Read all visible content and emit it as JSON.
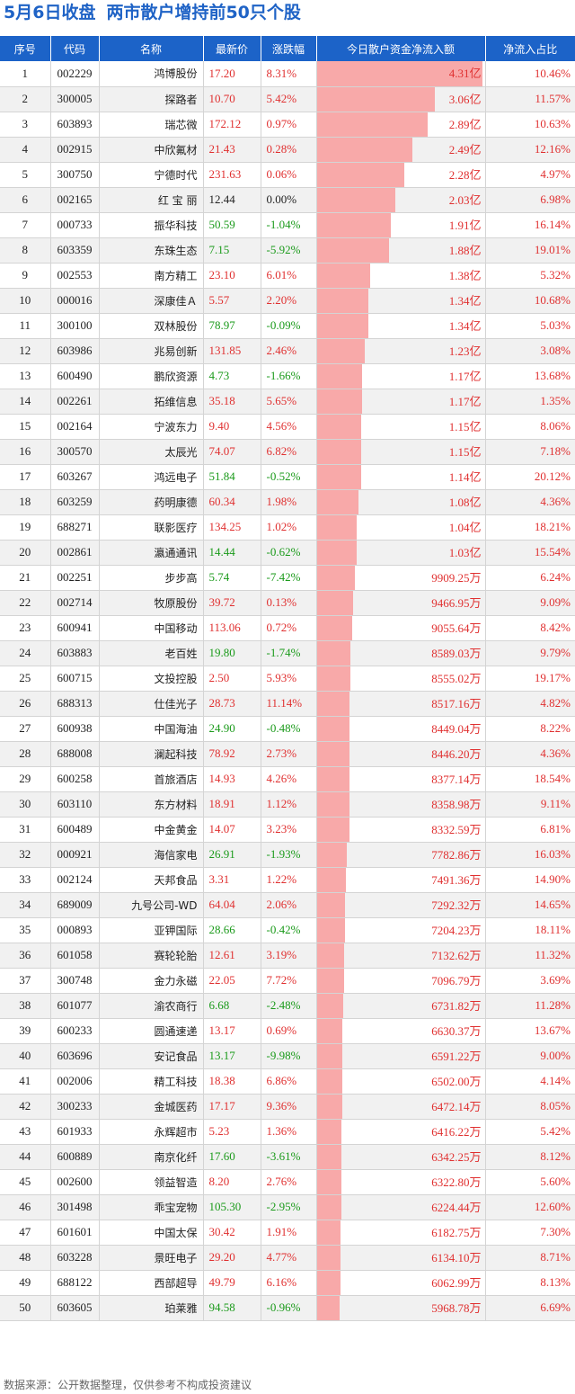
{
  "title": {
    "date": "5月6日收盘",
    "subject": "两市散户增持前50只个股"
  },
  "columns": [
    "序号",
    "代码",
    "名称",
    "最新价",
    "涨跌幅",
    "今日散户资金净流入额",
    "净流入占比"
  ],
  "colors": {
    "header_bg": "#1c63c8",
    "title": "#1f63c6",
    "bar": "#f8a9a9",
    "up": "#e03030",
    "down": "#1a9a1a"
  },
  "rows": [
    {
      "idx": "1",
      "code": "002229",
      "name": "鸿博股份",
      "price": "17.20",
      "chg": "8.31%",
      "flow": "4.31亿",
      "flow_yuan": 431000000,
      "pct": "10.46%"
    },
    {
      "idx": "2",
      "code": "300005",
      "name": "探路者",
      "price": "10.70",
      "chg": "5.42%",
      "flow": "3.06亿",
      "flow_yuan": 306000000,
      "pct": "11.57%"
    },
    {
      "idx": "3",
      "code": "603893",
      "name": "瑞芯微",
      "price": "172.12",
      "chg": "0.97%",
      "flow": "2.89亿",
      "flow_yuan": 289000000,
      "pct": "10.63%"
    },
    {
      "idx": "4",
      "code": "002915",
      "name": "中欣氟材",
      "price": "21.43",
      "chg": "0.28%",
      "flow": "2.49亿",
      "flow_yuan": 249000000,
      "pct": "12.16%"
    },
    {
      "idx": "5",
      "code": "300750",
      "name": "宁德时代",
      "price": "231.63",
      "chg": "0.06%",
      "flow": "2.28亿",
      "flow_yuan": 228000000,
      "pct": "4.97%"
    },
    {
      "idx": "6",
      "code": "002165",
      "name": "红 宝 丽",
      "price": "12.44",
      "chg": "0.00%",
      "flow": "2.03亿",
      "flow_yuan": 203000000,
      "pct": "6.98%"
    },
    {
      "idx": "7",
      "code": "000733",
      "name": "振华科技",
      "price": "50.59",
      "chg": "-1.04%",
      "flow": "1.91亿",
      "flow_yuan": 191000000,
      "pct": "16.14%"
    },
    {
      "idx": "8",
      "code": "603359",
      "name": "东珠生态",
      "price": "7.15",
      "chg": "-5.92%",
      "flow": "1.88亿",
      "flow_yuan": 188000000,
      "pct": "19.01%"
    },
    {
      "idx": "9",
      "code": "002553",
      "name": "南方精工",
      "price": "23.10",
      "chg": "6.01%",
      "flow": "1.38亿",
      "flow_yuan": 138000000,
      "pct": "5.32%"
    },
    {
      "idx": "10",
      "code": "000016",
      "name": "深康佳Ａ",
      "price": "5.57",
      "chg": "2.20%",
      "flow": "1.34亿",
      "flow_yuan": 134000000,
      "pct": "10.68%"
    },
    {
      "idx": "11",
      "code": "300100",
      "name": "双林股份",
      "price": "78.97",
      "chg": "-0.09%",
      "flow": "1.34亿",
      "flow_yuan": 134000000,
      "pct": "5.03%"
    },
    {
      "idx": "12",
      "code": "603986",
      "name": "兆易创新",
      "price": "131.85",
      "chg": "2.46%",
      "flow": "1.23亿",
      "flow_yuan": 123000000,
      "pct": "3.08%"
    },
    {
      "idx": "13",
      "code": "600490",
      "name": "鹏欣资源",
      "price": "4.73",
      "chg": "-1.66%",
      "flow": "1.17亿",
      "flow_yuan": 117000000,
      "pct": "13.68%"
    },
    {
      "idx": "14",
      "code": "002261",
      "name": "拓维信息",
      "price": "35.18",
      "chg": "5.65%",
      "flow": "1.17亿",
      "flow_yuan": 117000000,
      "pct": "1.35%"
    },
    {
      "idx": "15",
      "code": "002164",
      "name": "宁波东力",
      "price": "9.40",
      "chg": "4.56%",
      "flow": "1.15亿",
      "flow_yuan": 115000000,
      "pct": "8.06%"
    },
    {
      "idx": "16",
      "code": "300570",
      "name": "太辰光",
      "price": "74.07",
      "chg": "6.82%",
      "flow": "1.15亿",
      "flow_yuan": 115000000,
      "pct": "7.18%"
    },
    {
      "idx": "17",
      "code": "603267",
      "name": "鸿远电子",
      "price": "51.84",
      "chg": "-0.52%",
      "flow": "1.14亿",
      "flow_yuan": 114000000,
      "pct": "20.12%"
    },
    {
      "idx": "18",
      "code": "603259",
      "name": "药明康德",
      "price": "60.34",
      "chg": "1.98%",
      "flow": "1.08亿",
      "flow_yuan": 108000000,
      "pct": "4.36%"
    },
    {
      "idx": "19",
      "code": "688271",
      "name": "联影医疗",
      "price": "134.25",
      "chg": "1.02%",
      "flow": "1.04亿",
      "flow_yuan": 104000000,
      "pct": "18.21%"
    },
    {
      "idx": "20",
      "code": "002861",
      "name": "瀛通通讯",
      "price": "14.44",
      "chg": "-0.62%",
      "flow": "1.03亿",
      "flow_yuan": 103000000,
      "pct": "15.54%"
    },
    {
      "idx": "21",
      "code": "002251",
      "name": "步步高",
      "price": "5.74",
      "chg": "-7.42%",
      "flow": "9909.25万",
      "flow_yuan": 99092500,
      "pct": "6.24%"
    },
    {
      "idx": "22",
      "code": "002714",
      "name": "牧原股份",
      "price": "39.72",
      "chg": "0.13%",
      "flow": "9466.95万",
      "flow_yuan": 94669500,
      "pct": "9.09%"
    },
    {
      "idx": "23",
      "code": "600941",
      "name": "中国移动",
      "price": "113.06",
      "chg": "0.72%",
      "flow": "9055.64万",
      "flow_yuan": 90556400,
      "pct": "8.42%"
    },
    {
      "idx": "24",
      "code": "603883",
      "name": "老百姓",
      "price": "19.80",
      "chg": "-1.74%",
      "flow": "8589.03万",
      "flow_yuan": 85890300,
      "pct": "9.79%"
    },
    {
      "idx": "25",
      "code": "600715",
      "name": "文投控股",
      "price": "2.50",
      "chg": "5.93%",
      "flow": "8555.02万",
      "flow_yuan": 85550200,
      "pct": "19.17%"
    },
    {
      "idx": "26",
      "code": "688313",
      "name": "仕佳光子",
      "price": "28.73",
      "chg": "11.14%",
      "flow": "8517.16万",
      "flow_yuan": 85171600,
      "pct": "4.82%"
    },
    {
      "idx": "27",
      "code": "600938",
      "name": "中国海油",
      "price": "24.90",
      "chg": "-0.48%",
      "flow": "8449.04万",
      "flow_yuan": 84490400,
      "pct": "8.22%"
    },
    {
      "idx": "28",
      "code": "688008",
      "name": "澜起科技",
      "price": "78.92",
      "chg": "2.73%",
      "flow": "8446.20万",
      "flow_yuan": 84462000,
      "pct": "4.36%"
    },
    {
      "idx": "29",
      "code": "600258",
      "name": "首旅酒店",
      "price": "14.93",
      "chg": "4.26%",
      "flow": "8377.14万",
      "flow_yuan": 83771400,
      "pct": "18.54%"
    },
    {
      "idx": "30",
      "code": "603110",
      "name": "东方材料",
      "price": "18.91",
      "chg": "1.12%",
      "flow": "8358.98万",
      "flow_yuan": 83589800,
      "pct": "9.11%"
    },
    {
      "idx": "31",
      "code": "600489",
      "name": "中金黄金",
      "price": "14.07",
      "chg": "3.23%",
      "flow": "8332.59万",
      "flow_yuan": 83325900,
      "pct": "6.81%"
    },
    {
      "idx": "32",
      "code": "000921",
      "name": "海信家电",
      "price": "26.91",
      "chg": "-1.93%",
      "flow": "7782.86万",
      "flow_yuan": 77828600,
      "pct": "16.03%"
    },
    {
      "idx": "33",
      "code": "002124",
      "name": "天邦食品",
      "price": "3.31",
      "chg": "1.22%",
      "flow": "7491.36万",
      "flow_yuan": 74913600,
      "pct": "14.90%"
    },
    {
      "idx": "34",
      "code": "689009",
      "name": "九号公司-WD",
      "price": "64.04",
      "chg": "2.06%",
      "flow": "7292.32万",
      "flow_yuan": 72923200,
      "pct": "14.65%"
    },
    {
      "idx": "35",
      "code": "000893",
      "name": "亚钾国际",
      "price": "28.66",
      "chg": "-0.42%",
      "flow": "7204.23万",
      "flow_yuan": 72042300,
      "pct": "18.11%"
    },
    {
      "idx": "36",
      "code": "601058",
      "name": "赛轮轮胎",
      "price": "12.61",
      "chg": "3.19%",
      "flow": "7132.62万",
      "flow_yuan": 71326200,
      "pct": "11.32%"
    },
    {
      "idx": "37",
      "code": "300748",
      "name": "金力永磁",
      "price": "22.05",
      "chg": "7.72%",
      "flow": "7096.79万",
      "flow_yuan": 70967900,
      "pct": "3.69%"
    },
    {
      "idx": "38",
      "code": "601077",
      "name": "渝农商行",
      "price": "6.68",
      "chg": "-2.48%",
      "flow": "6731.82万",
      "flow_yuan": 67318200,
      "pct": "11.28%"
    },
    {
      "idx": "39",
      "code": "600233",
      "name": "圆通速递",
      "price": "13.17",
      "chg": "0.69%",
      "flow": "6630.37万",
      "flow_yuan": 66303700,
      "pct": "13.67%"
    },
    {
      "idx": "40",
      "code": "603696",
      "name": "安记食品",
      "price": "13.17",
      "chg": "-9.98%",
      "flow": "6591.22万",
      "flow_yuan": 65912200,
      "pct": "9.00%"
    },
    {
      "idx": "41",
      "code": "002006",
      "name": "精工科技",
      "price": "18.38",
      "chg": "6.86%",
      "flow": "6502.00万",
      "flow_yuan": 65020000,
      "pct": "4.14%"
    },
    {
      "idx": "42",
      "code": "300233",
      "name": "金城医药",
      "price": "17.17",
      "chg": "9.36%",
      "flow": "6472.14万",
      "flow_yuan": 64721400,
      "pct": "8.05%"
    },
    {
      "idx": "43",
      "code": "601933",
      "name": "永辉超市",
      "price": "5.23",
      "chg": "1.36%",
      "flow": "6416.22万",
      "flow_yuan": 64162200,
      "pct": "5.42%"
    },
    {
      "idx": "44",
      "code": "600889",
      "name": "南京化纤",
      "price": "17.60",
      "chg": "-3.61%",
      "flow": "6342.25万",
      "flow_yuan": 63422500,
      "pct": "8.12%"
    },
    {
      "idx": "45",
      "code": "002600",
      "name": "领益智造",
      "price": "8.20",
      "chg": "2.76%",
      "flow": "6322.80万",
      "flow_yuan": 63228000,
      "pct": "5.60%"
    },
    {
      "idx": "46",
      "code": "301498",
      "name": "乖宝宠物",
      "price": "105.30",
      "chg": "-2.95%",
      "flow": "6224.44万",
      "flow_yuan": 62244400,
      "pct": "12.60%"
    },
    {
      "idx": "47",
      "code": "601601",
      "name": "中国太保",
      "price": "30.42",
      "chg": "1.91%",
      "flow": "6182.75万",
      "flow_yuan": 61827500,
      "pct": "7.30%"
    },
    {
      "idx": "48",
      "code": "603228",
      "name": "景旺电子",
      "price": "29.20",
      "chg": "4.77%",
      "flow": "6134.10万",
      "flow_yuan": 61341000,
      "pct": "8.71%"
    },
    {
      "idx": "49",
      "code": "688122",
      "name": "西部超导",
      "price": "49.79",
      "chg": "6.16%",
      "flow": "6062.99万",
      "flow_yuan": 60629900,
      "pct": "8.13%"
    },
    {
      "idx": "50",
      "code": "603605",
      "name": "珀莱雅",
      "price": "94.58",
      "chg": "-0.96%",
      "flow": "5968.78万",
      "flow_yuan": 59687800,
      "pct": "6.69%"
    }
  ],
  "footer": "数据来源：公开数据整理，仅供参考不构成投资建议"
}
